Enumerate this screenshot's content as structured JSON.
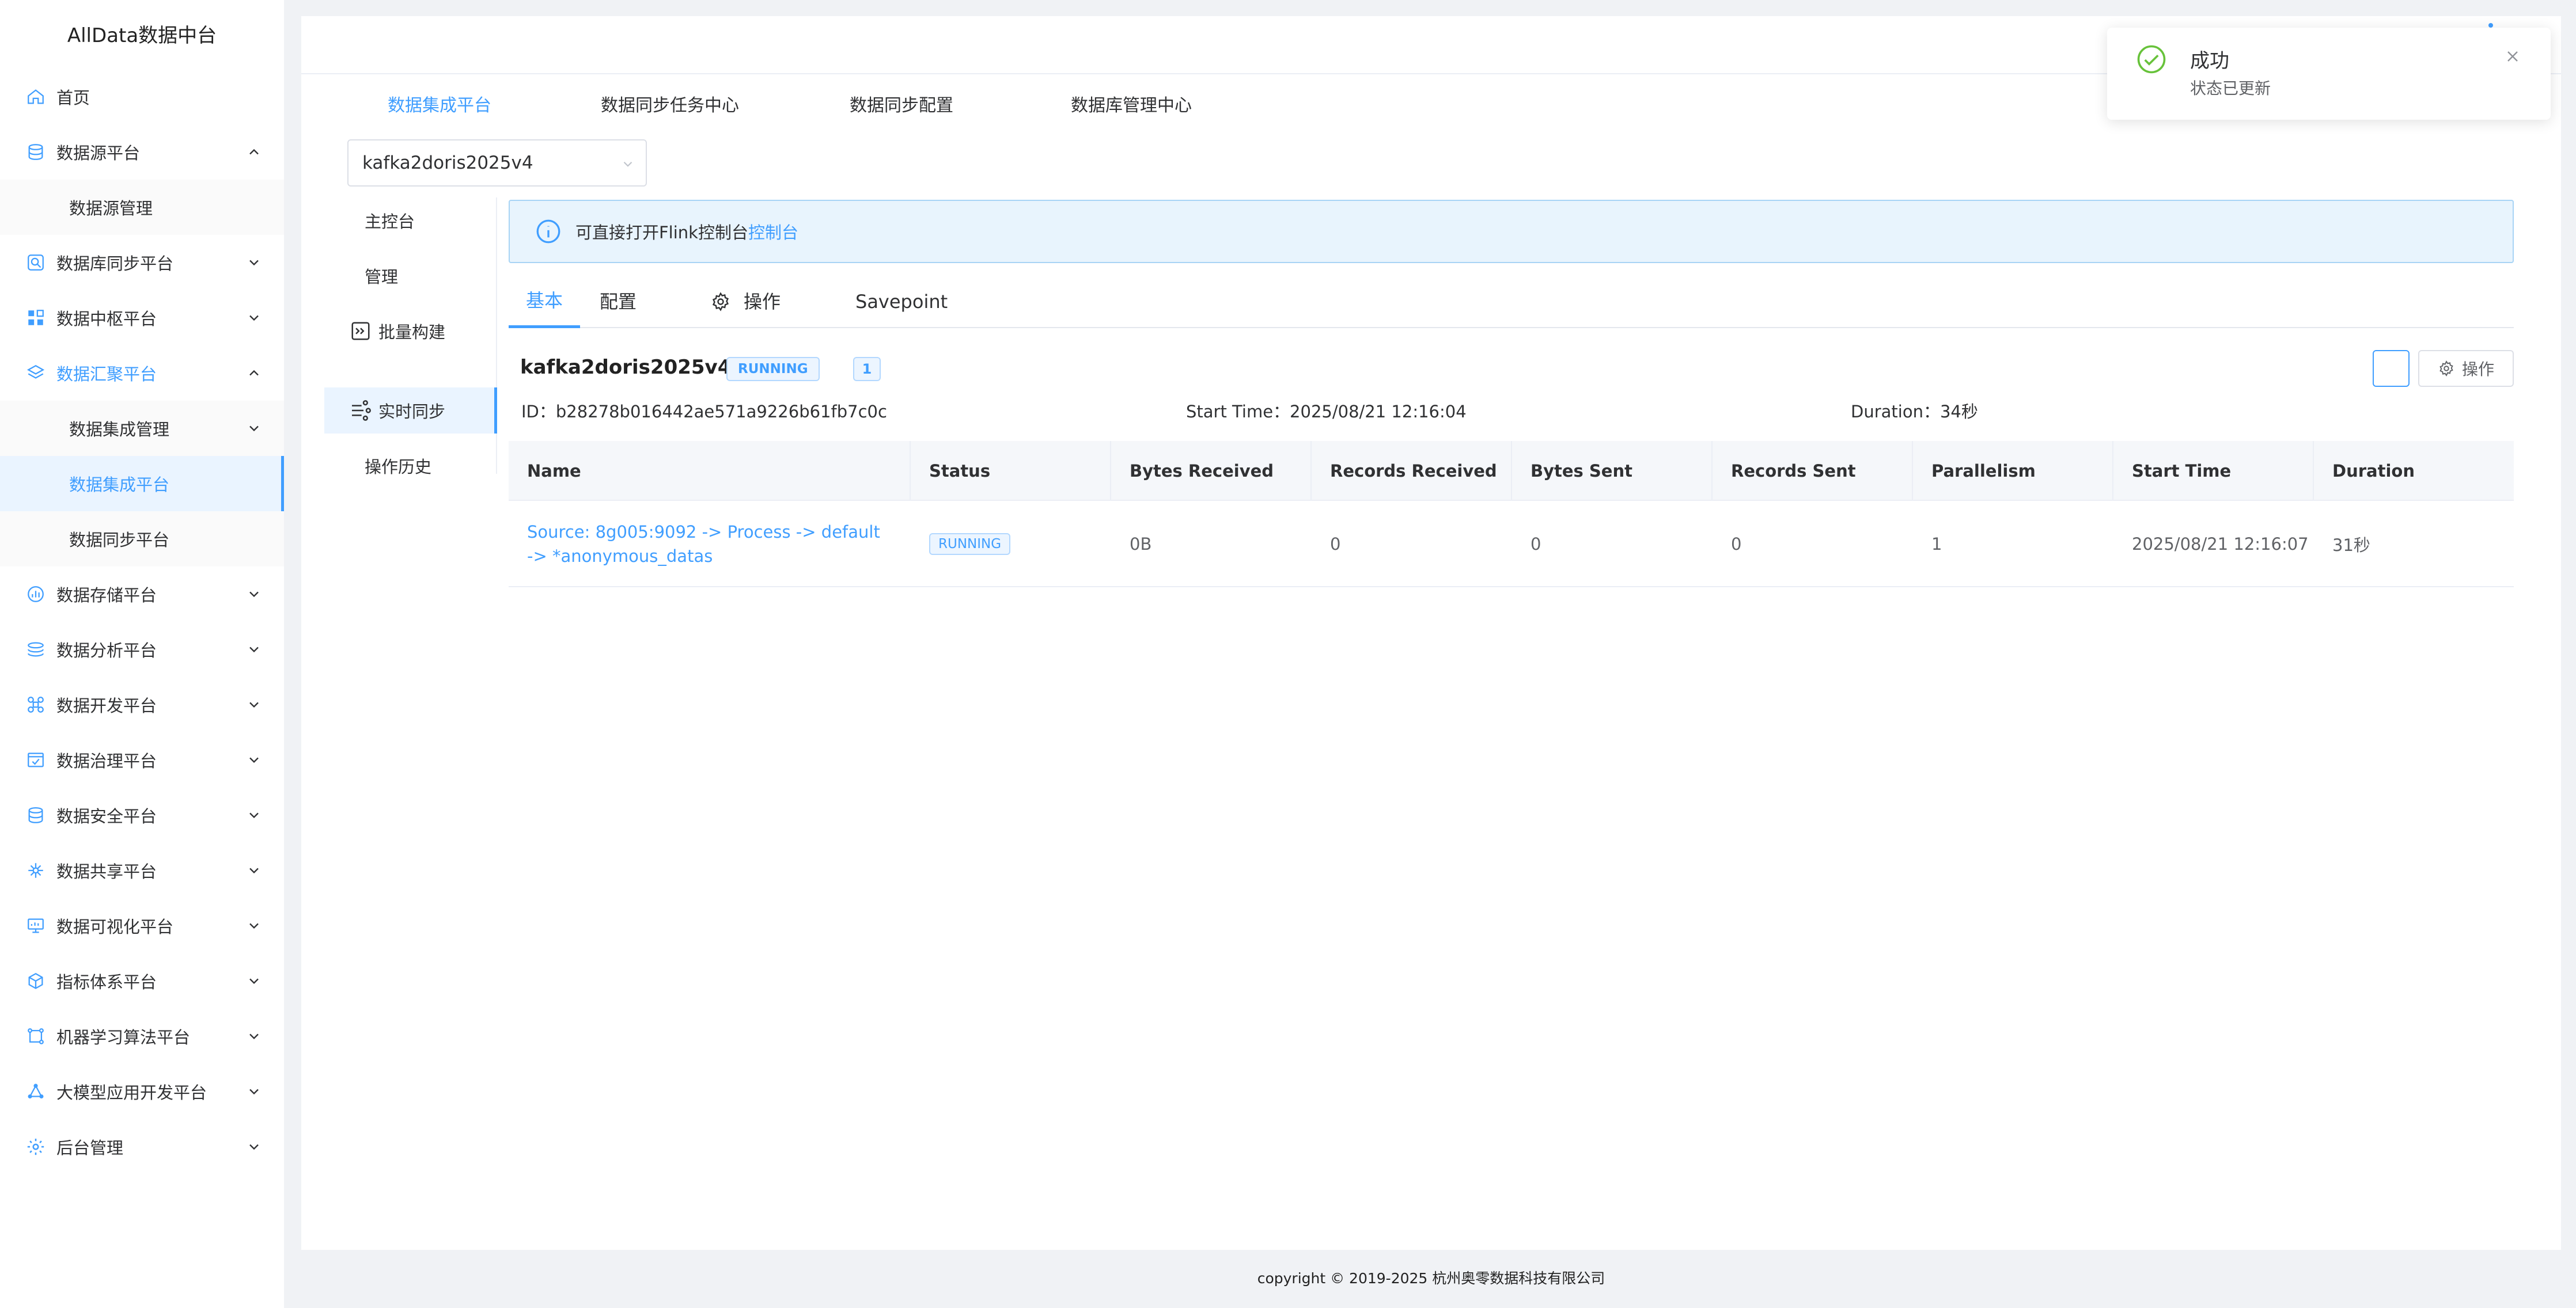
{
  "app_title": "AllData数据中台",
  "sidebar": {
    "items": [
      {
        "label": "首页",
        "icon": "home-icon"
      },
      {
        "label": "数据源平台",
        "icon": "database-icon",
        "expanded": true
      },
      {
        "label": "数据源管理",
        "sub": true
      },
      {
        "label": "数据库同步平台",
        "icon": "db-sync-icon"
      },
      {
        "label": "数据中枢平台",
        "icon": "grid-icon"
      },
      {
        "label": "数据汇聚平台",
        "icon": "layers-icon",
        "expanded": true,
        "active_parent": true
      },
      {
        "label": "数据集成管理",
        "sub": true,
        "has_arrow": true
      },
      {
        "label": "数据集成平台",
        "sub": true,
        "active": true
      },
      {
        "label": "数据同步平台",
        "sub": true
      },
      {
        "label": "数据存储平台",
        "icon": "storage-icon"
      },
      {
        "label": "数据分析平台",
        "icon": "analysis-icon"
      },
      {
        "label": "数据开发平台",
        "icon": "command-icon"
      },
      {
        "label": "数据治理平台",
        "icon": "governance-icon"
      },
      {
        "label": "数据安全平台",
        "icon": "security-icon"
      },
      {
        "label": "数据共享平台",
        "icon": "share-icon"
      },
      {
        "label": "数据可视化平台",
        "icon": "monitor-icon"
      },
      {
        "label": "指标体系平台",
        "icon": "cube-icon"
      },
      {
        "label": "机器学习算法平台",
        "icon": "ml-icon"
      },
      {
        "label": "大模型应用开发平台",
        "icon": "llm-icon"
      },
      {
        "label": "后台管理",
        "icon": "admin-icon"
      }
    ]
  },
  "top_tabs": [
    "数据集成平台",
    "数据同步任务中心",
    "数据同步配置",
    "数据库管理中心"
  ],
  "job_select": {
    "value": "kafka2doris2025v4"
  },
  "left_nav": [
    {
      "label": "主控台"
    },
    {
      "label": "管理"
    },
    {
      "label": "批量构建",
      "icon": "batch-icon"
    },
    {
      "label": "实时同步",
      "icon": "realtime-icon",
      "active": true
    },
    {
      "label": "操作历史"
    }
  ],
  "alert": {
    "text": "可直接打开Flink控制台",
    "link": "控制台"
  },
  "sub_tabs": [
    "基本",
    "配置",
    "操作",
    "Savepoint"
  ],
  "job": {
    "name": "kafka2doris2025v4",
    "status": "RUNNING",
    "count": "1",
    "id_label": "ID：",
    "id": "b28278b016442ae571a9226b61fb7c0c",
    "start_label": "Start Time：",
    "start": "2025/08/21 12:16:04",
    "duration_label": "Duration：",
    "duration": "34秒",
    "op_button": "操作"
  },
  "table": {
    "headers": [
      "Name",
      "Status",
      "Bytes Received",
      "Records Received",
      "Bytes Sent",
      "Records Sent",
      "Parallelism",
      "Start Time",
      "Duration"
    ],
    "rows": [
      [
        "Source: 8g005:9092 -> Process -> default -> *anonymous_datas",
        "RUNNING",
        "0B",
        "0",
        "0",
        "0",
        "1",
        "2025/08/21 12:16:07",
        "31秒"
      ]
    ]
  },
  "footer": "copyright © 2019-2025 杭州奥零数据科技有限公司",
  "toast": {
    "title": "成功",
    "message": "状态已更新"
  },
  "colors": {
    "accent": "#409eff",
    "success": "#67c23a"
  }
}
